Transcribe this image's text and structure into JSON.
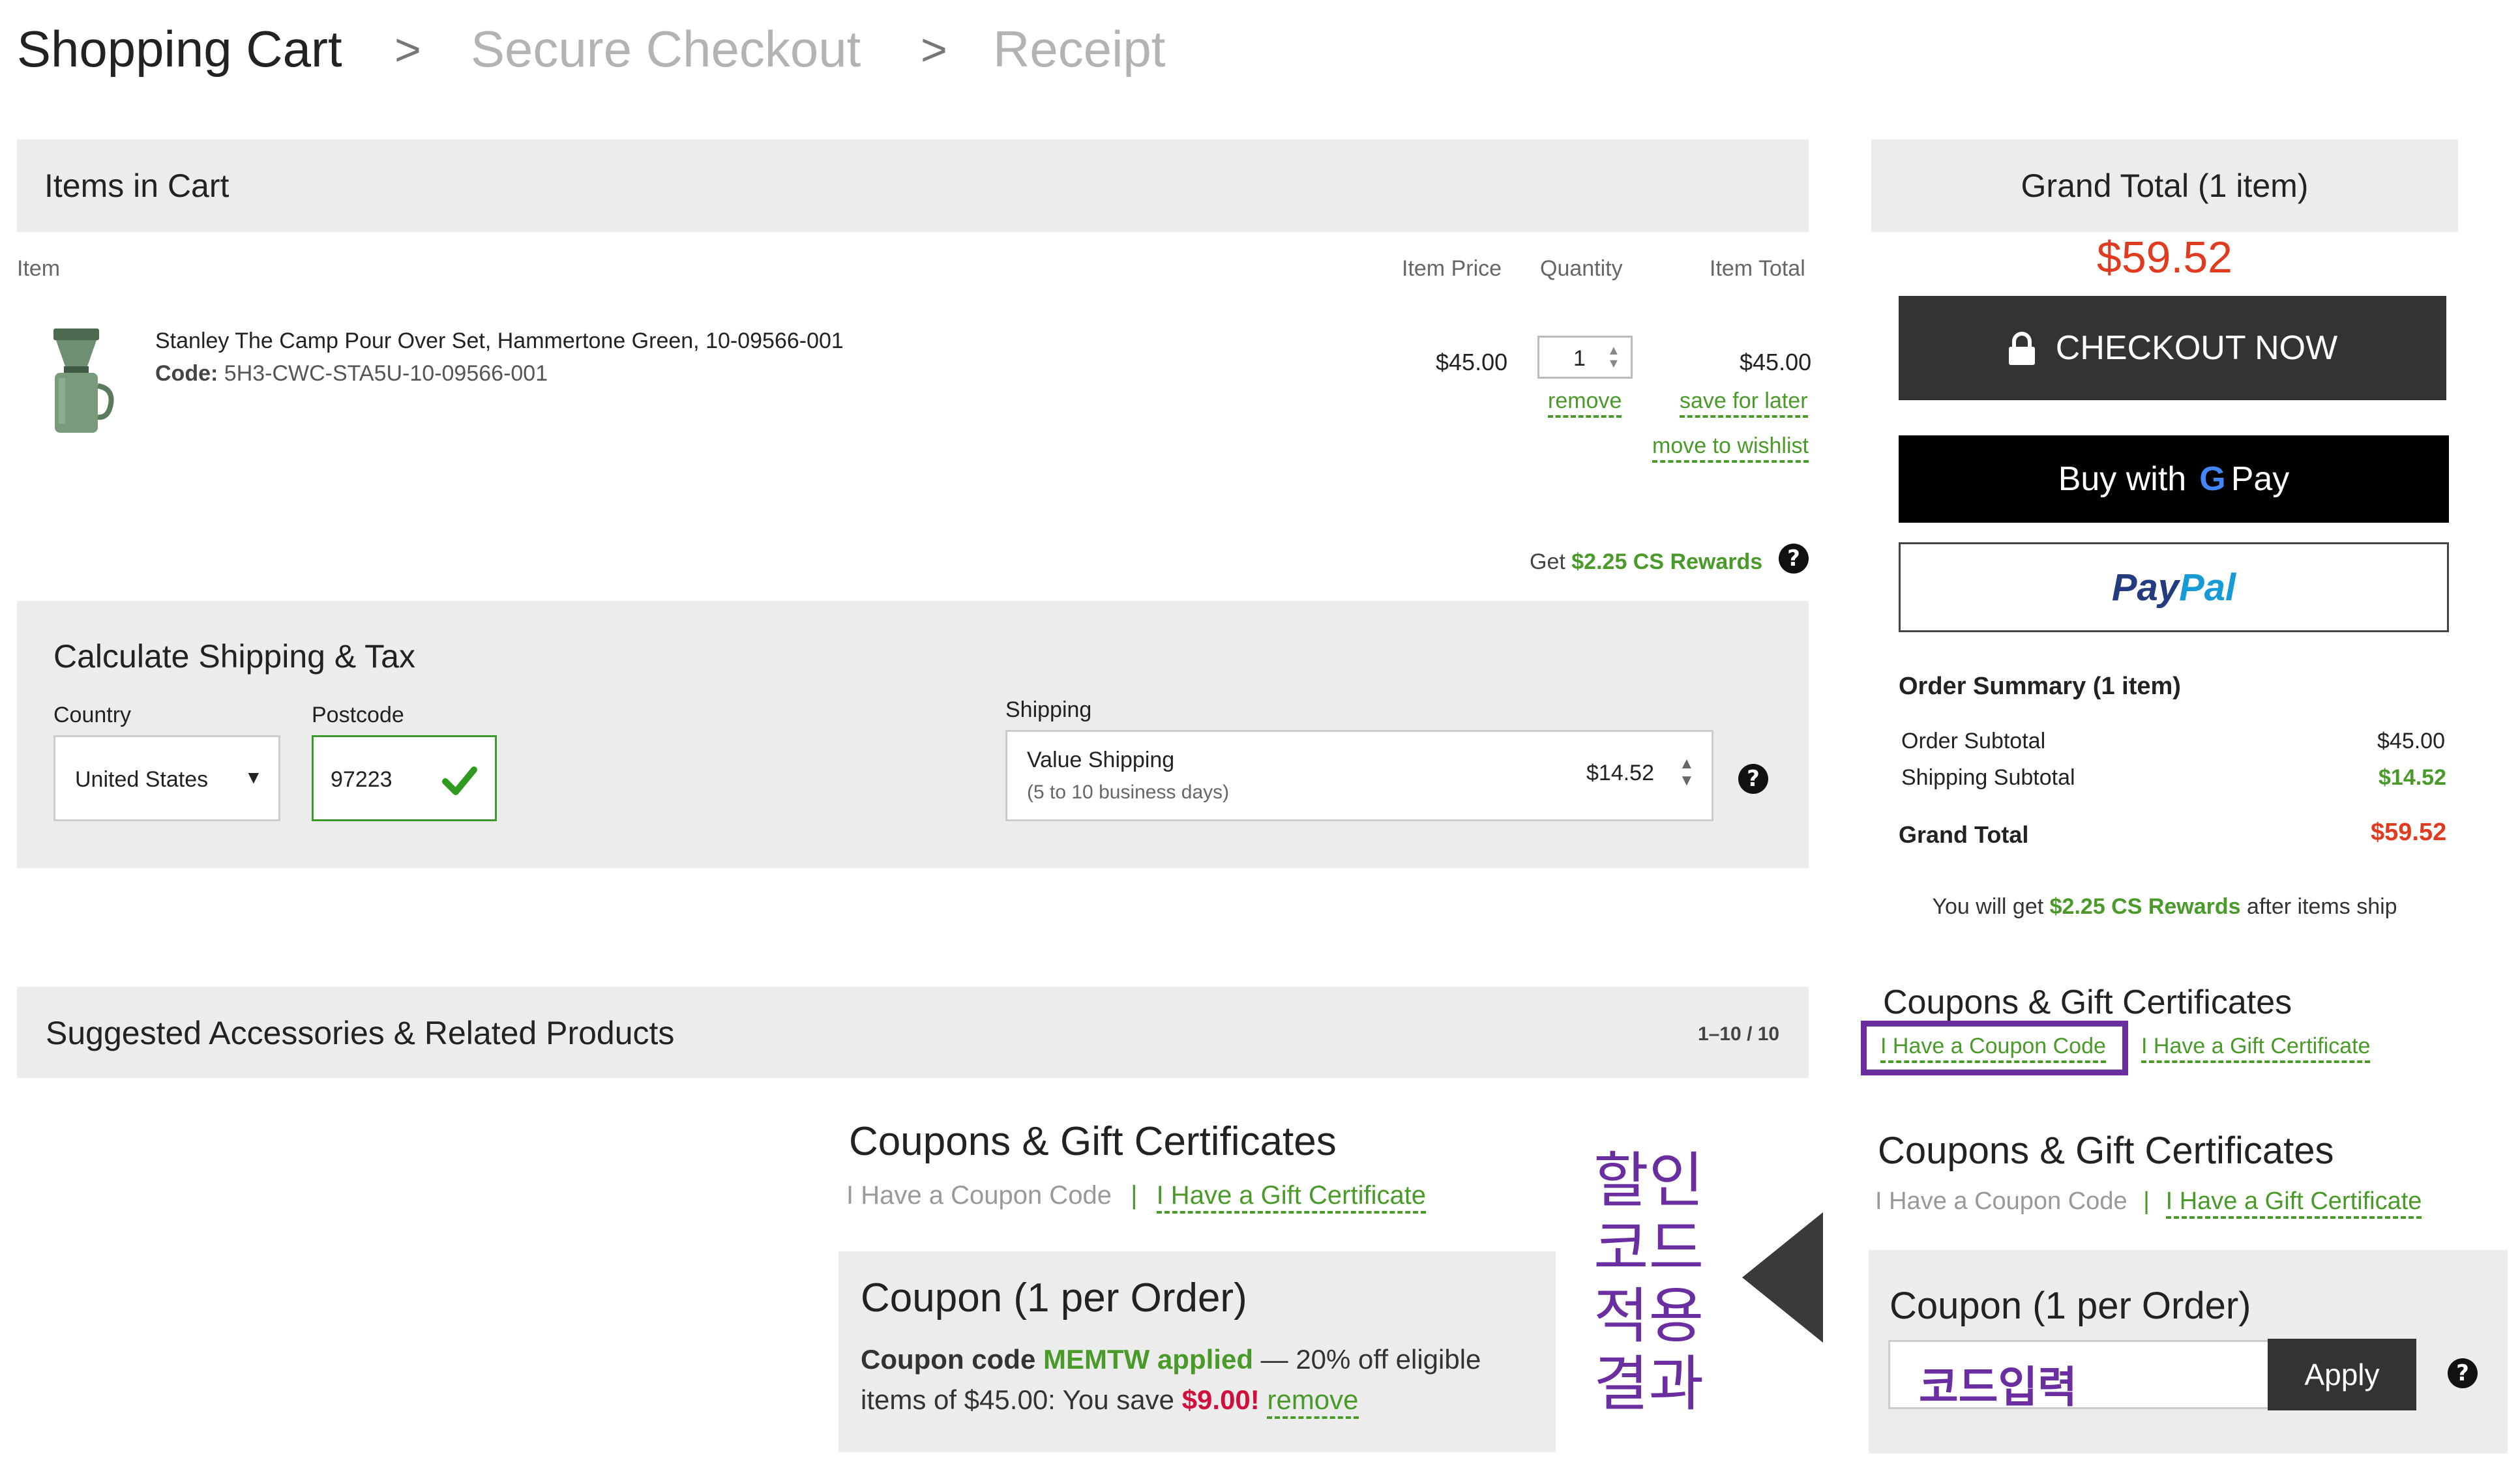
{
  "breadcrumb": {
    "step1": "Shopping Cart",
    "step2": "Secure Checkout",
    "step3": "Receipt",
    "separator": ">"
  },
  "cart": {
    "header": "Items in Cart",
    "columns": {
      "item": "Item",
      "price": "Item Price",
      "quantity": "Quantity",
      "total": "Item Total"
    },
    "item": {
      "name": "Stanley The Camp Pour Over Set, Hammertone Green, 10-09566-001",
      "code_label": "Code:",
      "code_value": "5H3-CWC-STA5U-10-09566-001",
      "price": "$45.00",
      "quantity": "1",
      "total": "$45.00",
      "remove": "remove",
      "save_for_later": "save for later",
      "move_to_wishlist": "move to wishlist"
    },
    "rewards_prefix": "Get",
    "rewards_value": "$2.25 CS Rewards"
  },
  "shipping_calc": {
    "title": "Calculate Shipping & Tax",
    "country_label": "Country",
    "country_value": "United States",
    "postcode_label": "Postcode",
    "postcode_value": "97223",
    "shipping_label": "Shipping",
    "shipping_method": "Value Shipping",
    "shipping_days": "(5 to 10 business days)",
    "shipping_price": "$14.52"
  },
  "suggested": {
    "title": "Suggested Accessories & Related Products",
    "pager": "1–10 / 10"
  },
  "summary": {
    "grand_total_header": "Grand Total (1 item)",
    "grand_total_big": "$59.52",
    "checkout_label": "CHECKOUT NOW",
    "gpay_prefix": "Buy with",
    "gpay_g": "G",
    "gpay_suffix": "Pay",
    "paypal_pay": "Pay",
    "paypal_pal": "Pal",
    "order_summary": "Order Summary (1 item)",
    "subtotal_label": "Order Subtotal",
    "subtotal_value": "$45.00",
    "shipping_subtotal_label": "Shipping Subtotal",
    "shipping_subtotal_value": "$14.52",
    "grand_total_label": "Grand Total",
    "grand_total_value": "$59.52",
    "rewards_prefix": "You will get",
    "rewards_value": "$2.25 CS Rewards",
    "rewards_suffix": "after items ship"
  },
  "coupons_top": {
    "title": "Coupons & Gift Certificates",
    "coupon_link": "I Have a Coupon Code",
    "gift_link": "I Have a Gift Certificate"
  },
  "coupons_result": {
    "title": "Coupons & Gift Certificates",
    "coupon_link": "I Have a Coupon Code",
    "divider": "|",
    "gift_link": "I Have a Gift Certificate",
    "box_title": "Coupon (1 per Order)",
    "line1_prefix": "Coupon code",
    "code": "MEMTW",
    "applied": "applied",
    "line1_suffix": "— 20% off eligible",
    "line2_prefix": "items of $45.00: You save",
    "savings": "$9.00",
    "exclaim": "!",
    "remove": "remove"
  },
  "coupons_entry": {
    "title": "Coupons & Gift Certificates",
    "coupon_link": "I Have a Coupon Code",
    "divider": "|",
    "gift_link": "I Have a Gift Certificate",
    "box_title": "Coupon (1 per Order)",
    "input_value": "코드입력",
    "apply": "Apply"
  },
  "annotation": {
    "line1": "할인",
    "line2": "코드",
    "line3": "적용",
    "line4": "결과"
  },
  "colors": {
    "green": "#4a9a2a",
    "red": "#e03a1f",
    "purple": "#6a2ea0",
    "dark_button": "#333333",
    "panel_gray": "#ececec"
  }
}
